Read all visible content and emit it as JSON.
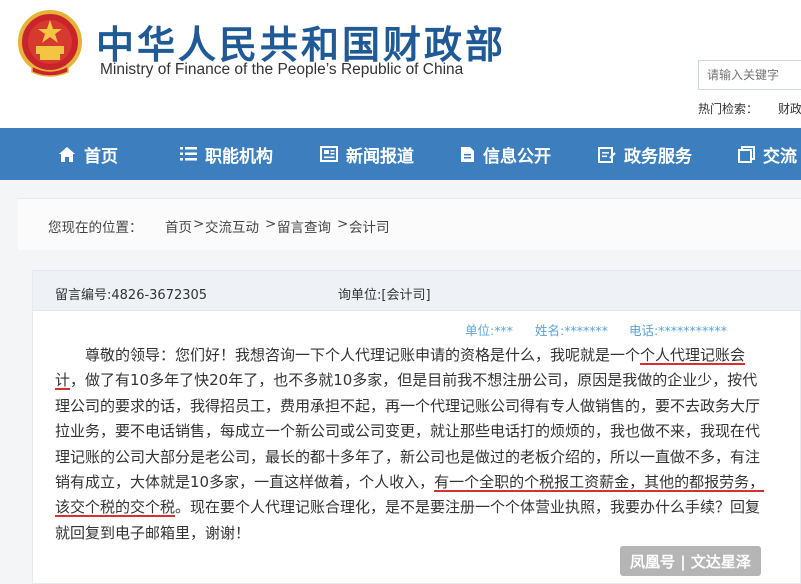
{
  "header": {
    "title": "中华人民共和国财政部",
    "subtitle": "Ministry of Finance of the People’s Republic of China",
    "search_placeholder": "请输入关键字",
    "hot_label": "热门检索：",
    "hot_link": "财政"
  },
  "nav": {
    "items": [
      {
        "label": "首页",
        "icon": "home-icon"
      },
      {
        "label": "职能机构",
        "icon": "list-icon"
      },
      {
        "label": "新闻报道",
        "icon": "newspaper-icon"
      },
      {
        "label": "信息公开",
        "icon": "document-icon"
      },
      {
        "label": "政务服务",
        "icon": "service-icon"
      },
      {
        "label": "交流",
        "icon": "copy-icon"
      }
    ],
    "bg_color": "#3d7fbe"
  },
  "breadcrumb": {
    "label": "您现在的位置：",
    "items": [
      "首页",
      "交流互动",
      "留言查询",
      "会计司"
    ],
    "separator": ">"
  },
  "message": {
    "number": "留言编号:4826-3672305",
    "to": "询单位:[会计司]",
    "unit": "单位:***",
    "name": "姓名:*******",
    "phone": "电话:***********",
    "p1": "尊敬的领导：您们好！我想咨询一下个人代理记账申请的资格是什么，我呢就是一个",
    "u1": "个人代理记账会计",
    "p2": "，做了有10多年了快20年了，也不多就10多家，但是目前我不想注册公司，原因是我做的企业少，按代理公司的要求的话，我得招员工，费用承担不起，再一个代理记账公司得有专人做销售的，要不去政务大厅拉业务，要不电话销售，每成立一个新公司或公司变更，就让那些电话打的烦烦的，我也做不来，我现在代理记账的公司大部分是老公司，最长的都十多年了，新公司也是做过的老板介绍的，所以一直做不多，有注销有成立，大体就是10多家，一直这样做着，个人收入，",
    "u2": "有一个全职的个税报工资薪金，其他的都报劳务，该交个税的交个税",
    "p3": "。现在要个人代理记账合理化，是不是要注册一个个体营业执照，我要办什么手续？回复就回复到电子邮箱里，谢谢！"
  },
  "watermark": "凤凰号 | 文达星泽",
  "colors": {
    "title_blue": "#1f5a97",
    "meta_blue": "#5aa4d8",
    "underline_red": "#d63131"
  }
}
